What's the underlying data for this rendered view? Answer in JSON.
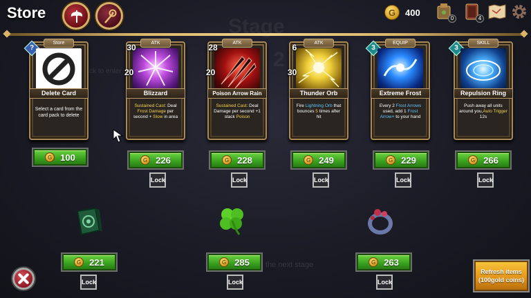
{
  "header": {
    "title": "Store",
    "gold": "400",
    "badges": [
      "0",
      "4"
    ]
  },
  "background": {
    "stage_title": "Stage",
    "stage_number": "2",
    "enter_hint": "back to enter",
    "next_hint": "the next stage"
  },
  "cards": [
    {
      "type": "Store",
      "cost": "?",
      "attack": "",
      "name": "Delete Card",
      "desc": "Select a card from the card pack to delete",
      "price": "100",
      "lock": ""
    },
    {
      "type": "ATK",
      "cost": "30",
      "attack": "20",
      "name": "Blizzard",
      "desc_parts": [
        "Sustained Cast:",
        " Deal ",
        "Frost Damage",
        " per second + ",
        "Slow",
        " in area"
      ],
      "price": "226",
      "lock": "Lock"
    },
    {
      "type": "ATK",
      "cost": "28",
      "attack": "20",
      "name": "Poison Arrow Rain",
      "desc_parts": [
        "Sustained Cast:",
        " Deal Damage per second +1 stack ",
        "Poison"
      ],
      "price": "228",
      "lock": "Lock"
    },
    {
      "type": "ATK",
      "cost": "6",
      "attack": "30",
      "name": "Thunder Orb",
      "desc_parts": [
        "Fire ",
        "Lightning Orb",
        " that bounces ",
        "5",
        " times after hit"
      ],
      "price": "249",
      "lock": "Lock"
    },
    {
      "type": "EQUIP",
      "cost": "3",
      "attack": "",
      "name": "Extreme Frost",
      "desc_parts": [
        "Every 2 ",
        "Frost Arrows",
        " used, add 1 ",
        "Frost Arrow+",
        " to your hand"
      ],
      "price": "229",
      "lock": "Lock"
    },
    {
      "type": "SKILL",
      "cost": "3",
      "attack": "",
      "name": "Repulsion Ring",
      "desc_parts": [
        "Push away all units around you,",
        "Auto Trigger",
        " 12s"
      ],
      "price": "266",
      "lock": "Lock"
    }
  ],
  "items": [
    {
      "icon": "green-tome-icon",
      "price": "221",
      "lock": "Lock"
    },
    {
      "icon": "four-leaf-clover-icon",
      "price": "285",
      "lock": "Lock"
    },
    {
      "icon": "gem-ring-icon",
      "price": "263",
      "lock": "Lock"
    }
  ],
  "refresh": {
    "line1": "Refresh items",
    "line2": "(100gold coins)"
  },
  "colors": {
    "price_green": "#38a01e",
    "gold": "#d19a1e",
    "refresh_orange": "#e2931a",
    "highlight_yellow": "#f7d44a",
    "highlight_blue": "#5fc8ff"
  }
}
